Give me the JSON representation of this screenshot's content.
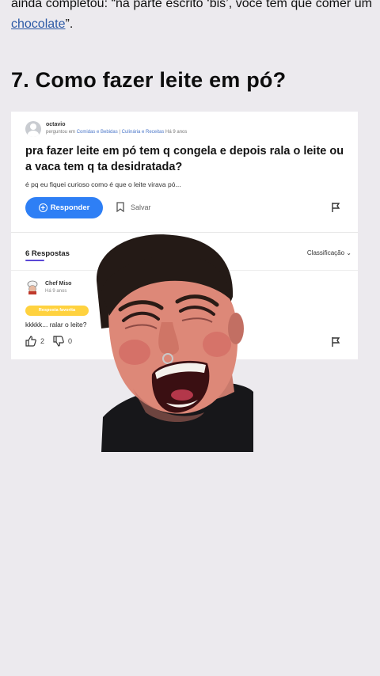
{
  "article": {
    "para_part1": "ainda completou: “na parte escrito ‘bis’, você tem que comer um ",
    "link_text": "chocolate",
    "para_part2": "”."
  },
  "section_title": "7. Como fazer leite em pó?",
  "question": {
    "user": "octavio",
    "asked_in": "perguntou em",
    "category1": "Comidas e Bebidas",
    "separator": "|",
    "category2": "Culinária e Receitas",
    "time": "Há 9 anos",
    "title": "pra fazer leite em pó tem q congela e depois rala o leite ou a vaca tem q ta desidratada?",
    "body": "é pq eu fiquei curioso como é que o leite virava pó...",
    "answer_button": "Responder",
    "save_label": "Salvar"
  },
  "answers": {
    "count_label": "6 Respostas",
    "sort_label": "Classificação",
    "items": [
      {
        "user": "Chef Miso",
        "time": "Há 9 anos",
        "badge": "Resposta favorita",
        "text": "kkkkk... ralar o leite?",
        "likes": "2",
        "dislikes": "0"
      }
    ]
  },
  "colors": {
    "accent": "#2e7ff5",
    "badge": "#ffd23f",
    "tab_underline": "#5b48d6"
  }
}
